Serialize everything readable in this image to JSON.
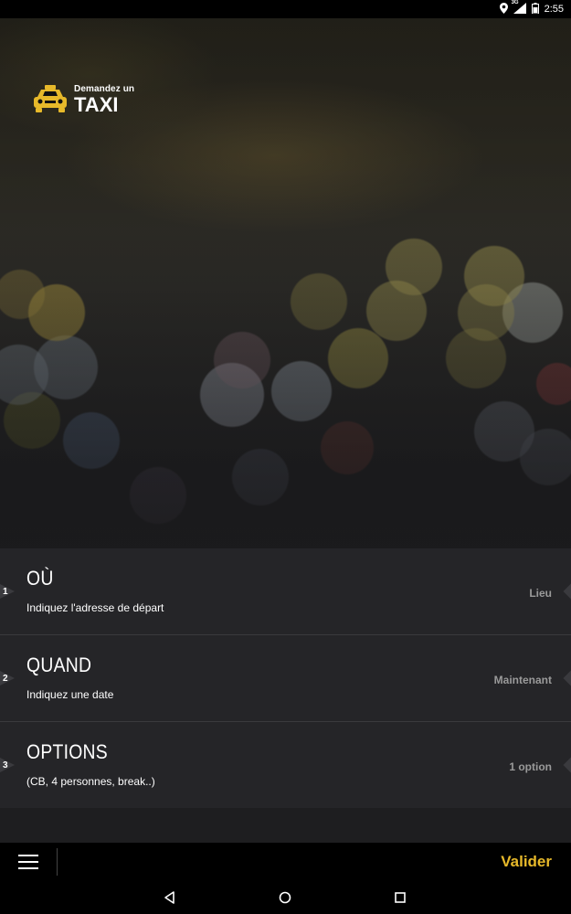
{
  "status_bar": {
    "time": "2:55",
    "network": "3G",
    "icons": [
      "location-icon",
      "signal-icon",
      "battery-icon"
    ]
  },
  "logo": {
    "small_text": "Demandez un",
    "big_text": "TAXI",
    "icon": "taxi-icon"
  },
  "rows": [
    {
      "step": "1",
      "title": "OÙ",
      "subtitle": "Indiquez l'adresse de départ",
      "value": "Lieu"
    },
    {
      "step": "2",
      "title": "QUAND",
      "subtitle": "Indiquez une date",
      "value": "Maintenant"
    },
    {
      "step": "3",
      "title": "OPTIONS",
      "subtitle": "(CB, 4 personnes, break..)",
      "value": "1 option"
    }
  ],
  "action_bar": {
    "menu_icon": "hamburger-menu-icon",
    "validate_label": "Valider"
  },
  "nav_bar": {
    "icons": [
      "back-icon",
      "home-icon",
      "recents-icon"
    ]
  },
  "colors": {
    "accent": "#e7b92a",
    "row_bg": "#252528",
    "value_text": "#9a9a9a"
  }
}
